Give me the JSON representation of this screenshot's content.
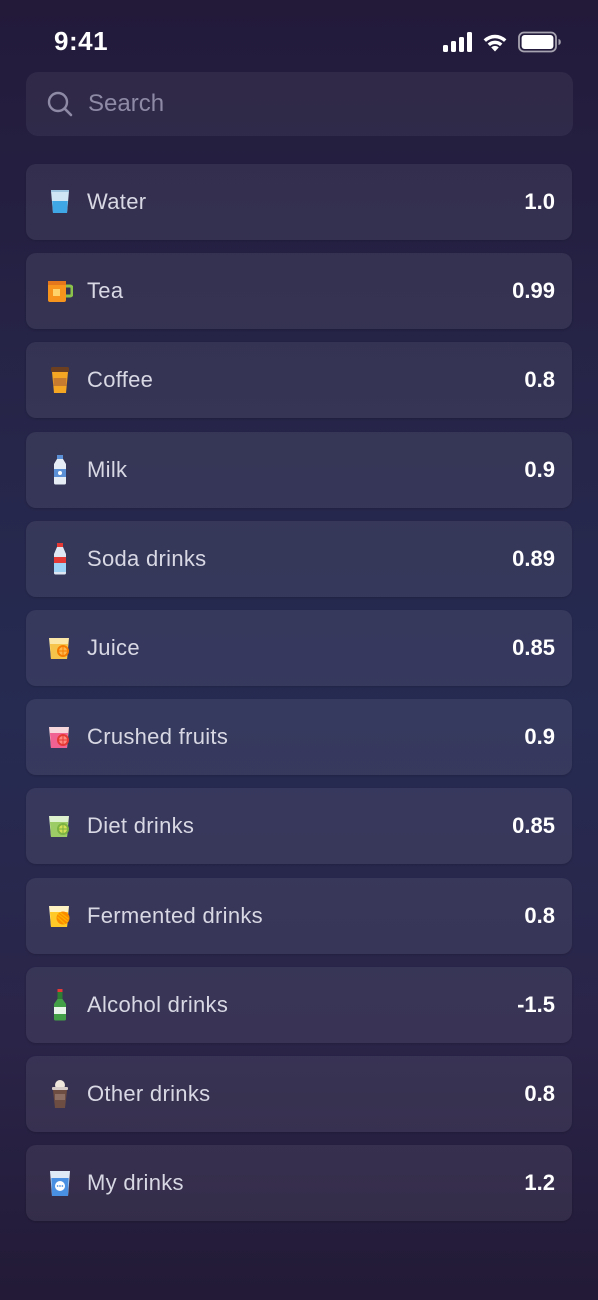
{
  "status_bar": {
    "time": "9:41",
    "icons": [
      "signal-icon",
      "wifi-icon",
      "battery-icon"
    ]
  },
  "search": {
    "placeholder": "Search",
    "value": "",
    "icon": "search-icon"
  },
  "drinks": [
    {
      "name": "Water",
      "value": "1.0",
      "icon": "glass-of-water-icon"
    },
    {
      "name": "Tea",
      "value": "0.99",
      "icon": "tea-mug-icon"
    },
    {
      "name": "Coffee",
      "value": "0.8",
      "icon": "coffee-cup-icon"
    },
    {
      "name": "Milk",
      "value": "0.9",
      "icon": "milk-bottle-icon"
    },
    {
      "name": "Soda drinks",
      "value": "0.89",
      "icon": "soda-bottle-icon"
    },
    {
      "name": "Juice",
      "value": "0.85",
      "icon": "juice-glass-icon"
    },
    {
      "name": "Crushed fruits",
      "value": "0.9",
      "icon": "crushed-fruits-icon"
    },
    {
      "name": "Diet drinks",
      "value": "0.85",
      "icon": "diet-drink-icon"
    },
    {
      "name": "Fermented drinks",
      "value": "0.8",
      "icon": "fermented-drink-icon"
    },
    {
      "name": "Alcohol drinks",
      "value": "-1.5",
      "icon": "alcohol-bottle-icon"
    },
    {
      "name": "Other drinks",
      "value": "0.8",
      "icon": "other-drink-icon"
    },
    {
      "name": "My drinks",
      "value": "1.2",
      "icon": "my-drink-cup-icon"
    }
  ]
}
